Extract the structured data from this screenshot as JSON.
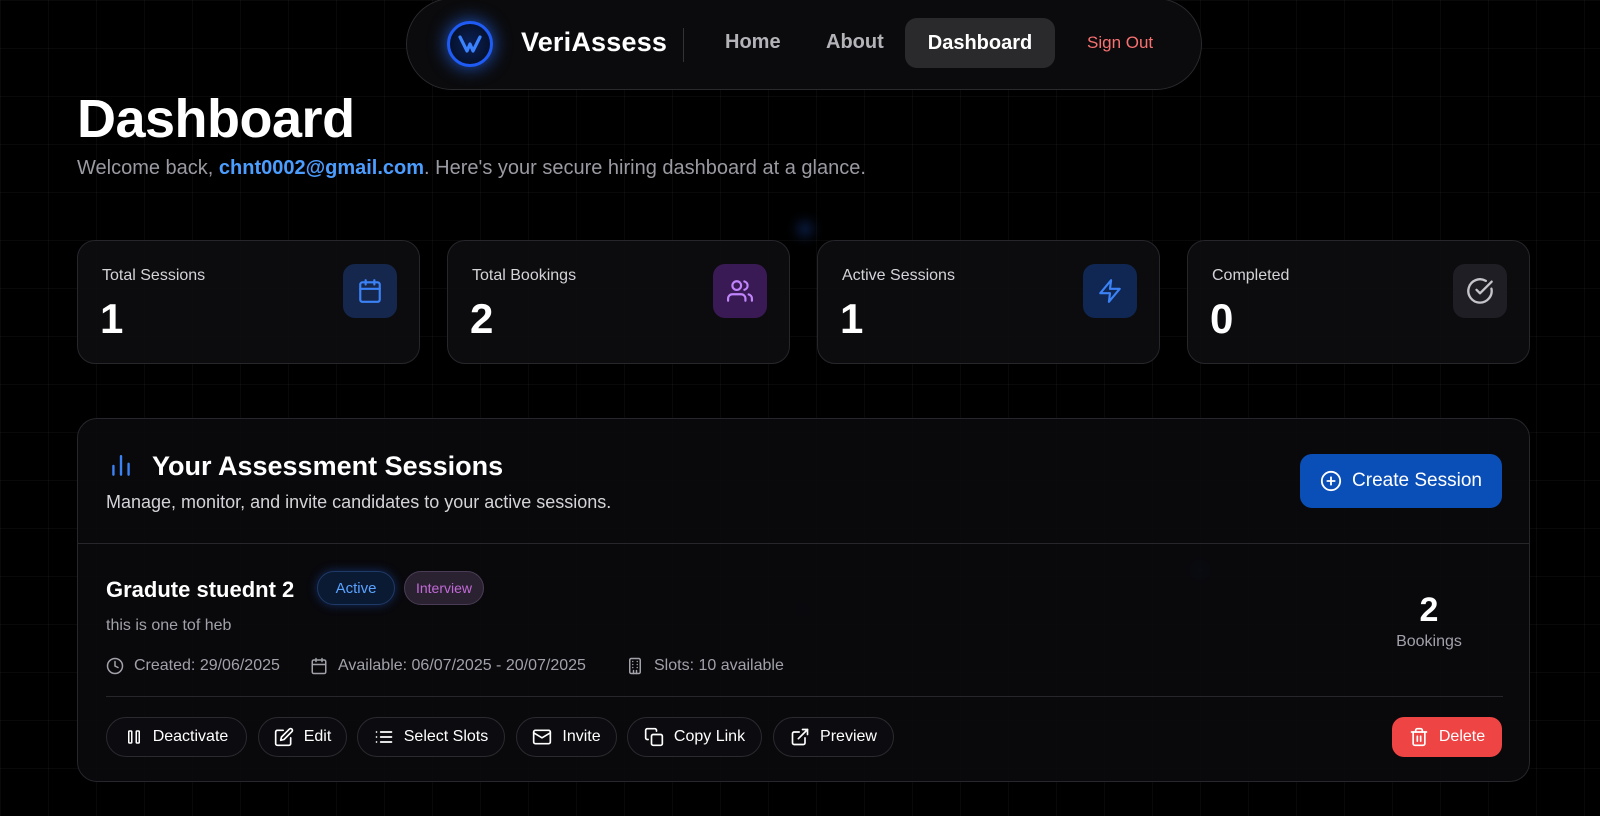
{
  "nav": {
    "brand": "VeriAssess",
    "links": [
      "Home",
      "About",
      "Dashboard"
    ],
    "active": "Dashboard",
    "sign_out": "Sign Out"
  },
  "header": {
    "title": "Dashboard",
    "welcome_prefix": "Welcome back, ",
    "email": "chnt0002@gmail.com",
    "welcome_suffix": ". Here's your secure hiring dashboard at a glance."
  },
  "stats": [
    {
      "label": "Total Sessions",
      "value": "1",
      "icon": "calendar-icon",
      "color": "#3b82f6"
    },
    {
      "label": "Total Bookings",
      "value": "2",
      "icon": "users-icon",
      "color": "#a855f7"
    },
    {
      "label": "Active Sessions",
      "value": "1",
      "icon": "lightning-icon",
      "color": "#3b82f6"
    },
    {
      "label": "Completed",
      "value": "0",
      "icon": "check-circle-icon",
      "color": "#a1a1aa"
    }
  ],
  "sessions_panel": {
    "title": "Your Assessment Sessions",
    "subtitle": "Manage, monitor, and invite candidates to your active sessions.",
    "create_button": "Create Session",
    "session": {
      "name": "Gradute stuednt 2",
      "status": "Active",
      "type": "Interview",
      "description": "this is one tof heb",
      "created": "Created: 29/06/2025",
      "available": "Available: 06/07/2025 - 20/07/2025",
      "slots": "Slots: 10 available",
      "bookings_count": "2",
      "bookings_label": "Bookings",
      "actions": {
        "deactivate": "Deactivate",
        "edit": "Edit",
        "select_slots": "Select Slots",
        "invite": "Invite",
        "copy_link": "Copy Link",
        "preview": "Preview",
        "delete": "Delete"
      }
    }
  },
  "colors": {
    "accent": "#0a4fb8",
    "link": "#4b9dff",
    "danger": "#ef4444",
    "sign_out": "#f87171"
  }
}
